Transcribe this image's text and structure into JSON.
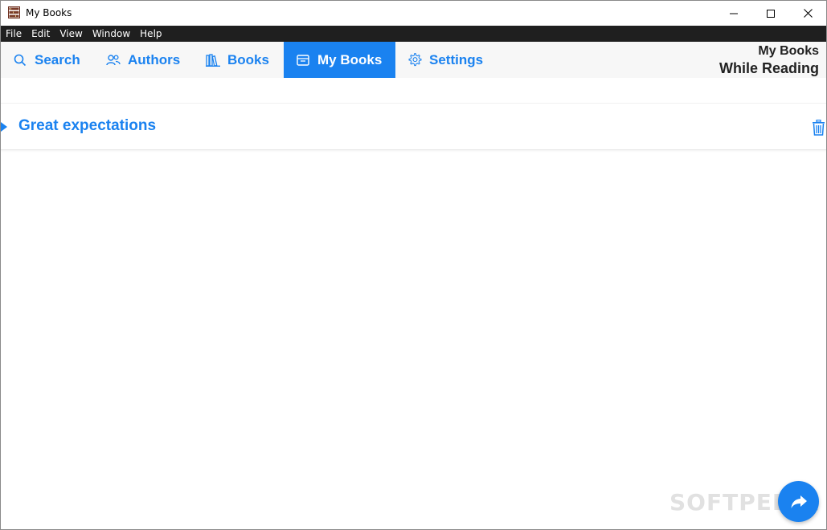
{
  "window": {
    "title": "My Books",
    "app_icon": "bookshelf-icon",
    "controls": [
      "minimize-icon",
      "maximize-icon",
      "close-icon"
    ]
  },
  "menu": {
    "items": [
      "File",
      "Edit",
      "View",
      "Window",
      "Help"
    ]
  },
  "nav": {
    "tabs": [
      {
        "label": "Search",
        "icon": "search-icon",
        "active": false
      },
      {
        "label": "Authors",
        "icon": "users-icon",
        "active": false
      },
      {
        "label": "Books",
        "icon": "books-icon",
        "active": false
      },
      {
        "label": "My Books",
        "icon": "inbox-icon",
        "active": true
      },
      {
        "label": "Settings",
        "icon": "gear-icon",
        "active": false
      }
    ],
    "right_title": "My Books",
    "right_subtitle": "While Reading"
  },
  "list": {
    "items": [
      {
        "title": "Great expectations",
        "icon": "trash-icon"
      }
    ]
  },
  "watermark": "SOFTPEDIA",
  "fab": {
    "icon": "share-icon"
  },
  "colors": {
    "accent": "#1a82f0",
    "menubar": "#1f1f1f",
    "navbar": "#f7f7f7"
  }
}
